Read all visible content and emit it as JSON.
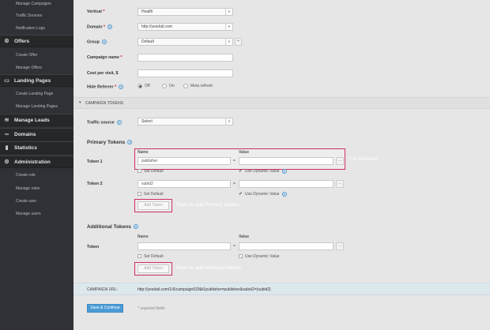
{
  "sidebar": {
    "groups": [
      {
        "head": null,
        "items": [
          "Manage Campaigns",
          "Traffic Sources",
          "Notification Logs"
        ]
      },
      {
        "head": "Offers",
        "icon": "gear-icon",
        "items": [
          "Create Offer",
          "Manage Offers"
        ]
      },
      {
        "head": "Landing Pages",
        "icon": "page-icon",
        "items": [
          "Create Landing Page",
          "Manage Landing Pages"
        ]
      },
      {
        "head": "Manage Leads",
        "icon": "database-icon",
        "items": []
      },
      {
        "head": "Domains",
        "icon": "link-icon",
        "items": []
      },
      {
        "head": "Statistics",
        "icon": "chart-icon",
        "items": []
      },
      {
        "head": "Administration",
        "icon": "gear-icon",
        "items": [
          "Create role",
          "Manage roles",
          "Create user",
          "Manage users"
        ]
      }
    ]
  },
  "form": {
    "vertical": {
      "label": "Vertical",
      "value": "Health"
    },
    "domain": {
      "label": "Domain",
      "value": "http://yesdail.com"
    },
    "group": {
      "label": "Group",
      "value": "Default",
      "add": "+"
    },
    "campaign_name": {
      "label": "Campaign name",
      "value": ""
    },
    "cost_per_visit": {
      "label": "Cost per visit, $",
      "value": ""
    },
    "hide_referrer": {
      "label": "Hide Referrer",
      "options": [
        "Off",
        "On",
        "Meta refresh"
      ],
      "selected": 0
    },
    "required_mark": "*"
  },
  "campaign_tokens": {
    "header": "CAMPAIGN TOKENS",
    "traffic_source": {
      "label": "Traffic source",
      "value": "Select"
    }
  },
  "primary_tokens": {
    "title": "Primary Tokens",
    "col_name": "Name",
    "col_value": "Value",
    "rows": [
      {
        "label": "Token 1",
        "name": "publisher",
        "value": "",
        "set_default": "Set Default",
        "use_dynamic": "Use Dynamic Value"
      },
      {
        "label": "Token 2",
        "name": "subid2",
        "value": "",
        "set_default": "Set Default",
        "use_dynamic": "Use Dynamic Value"
      }
    ],
    "eq": "=",
    "more": "...",
    "add_button": "Add Token",
    "hint_add": "Push to add Primary tokens",
    "hint_instance": "For instance"
  },
  "additional_tokens": {
    "title": "Additional Tokens",
    "col_name": "Name",
    "col_value": "Value",
    "row_label": "Token",
    "eq": "=",
    "more": "...",
    "set_default": "Set Default",
    "use_dynamic": "Use Dynamic Value",
    "add_button": "Add Token",
    "hint_add": "Push to add Aditional tokens"
  },
  "campaign_url": {
    "label": "CAMPAIGN URL:",
    "value": "http://yesdail.com/1/6/campaign529&t1publisher=publisher&subid2={subid2}"
  },
  "footer": {
    "save_button": "Save & Continue",
    "required_note": "* required fields"
  },
  "colors": {
    "accent": "#cf2c61",
    "sidebar_bg": "#2f3136",
    "help": "#4a9bd6",
    "button": "#4a9bd6"
  }
}
